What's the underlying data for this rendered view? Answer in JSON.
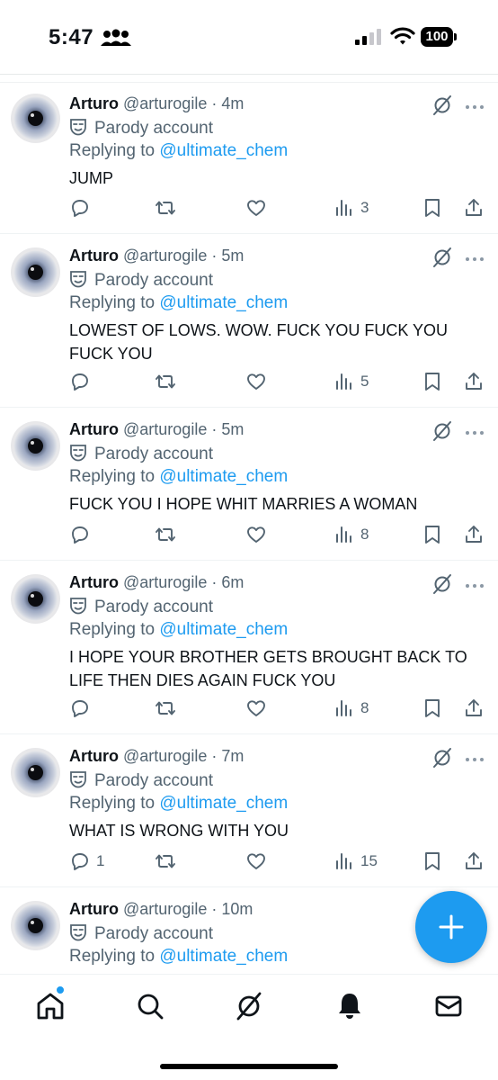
{
  "status_bar": {
    "time": "5:47",
    "battery": "100"
  },
  "tweets": [
    {
      "name": "Arturo",
      "handle": "@arturogile",
      "time": "· 4m",
      "parody": "Parody account",
      "reply_prefix": "Replying to ",
      "reply_to": "@ultimate_chem",
      "text": "JUMP",
      "replies": "",
      "views": "3"
    },
    {
      "name": "Arturo",
      "handle": "@arturogile",
      "time": "· 5m",
      "parody": "Parody account",
      "reply_prefix": "Replying to ",
      "reply_to": "@ultimate_chem",
      "text": "LOWEST OF LOWS. WOW. FUCK YOU FUCK YOU FUCK YOU",
      "replies": "",
      "views": "5"
    },
    {
      "name": "Arturo",
      "handle": "@arturogile",
      "time": "· 5m",
      "parody": "Parody account",
      "reply_prefix": "Replying to ",
      "reply_to": "@ultimate_chem",
      "text": "FUCK YOU I HOPE WHIT MARRIES A WOMAN",
      "replies": "",
      "views": "8"
    },
    {
      "name": "Arturo",
      "handle": "@arturogile",
      "time": "· 6m",
      "parody": "Parody account",
      "reply_prefix": "Replying to ",
      "reply_to": "@ultimate_chem",
      "text": "I HOPE YOUR BROTHER GETS BROUGHT BACK TO LIFE THEN DIES AGAIN FUCK YOU",
      "replies": "",
      "views": "8"
    },
    {
      "name": "Arturo",
      "handle": "@arturogile",
      "time": "· 7m",
      "parody": "Parody account",
      "reply_prefix": "Replying to ",
      "reply_to": "@ultimate_chem",
      "text": "WHAT IS WRONG WITH YOU",
      "replies": "1",
      "views": "15"
    },
    {
      "name": "Arturo",
      "handle": "@arturogile",
      "time": "· 10m",
      "parody": "Parody account",
      "reply_prefix": "Replying to ",
      "reply_to": "@ultimate_chem",
      "text": "",
      "replies": "",
      "views": ""
    }
  ],
  "icons": {
    "reply": "reply-icon",
    "retweet": "retweet-icon",
    "like": "heart-icon",
    "views": "views-icon",
    "bookmark": "bookmark-icon",
    "share": "share-icon",
    "grok": "grok-icon",
    "more": "more-icon"
  },
  "colors": {
    "accent": "#1d9bf0",
    "secondary_text": "#536471",
    "primary_text": "#0f1419"
  }
}
